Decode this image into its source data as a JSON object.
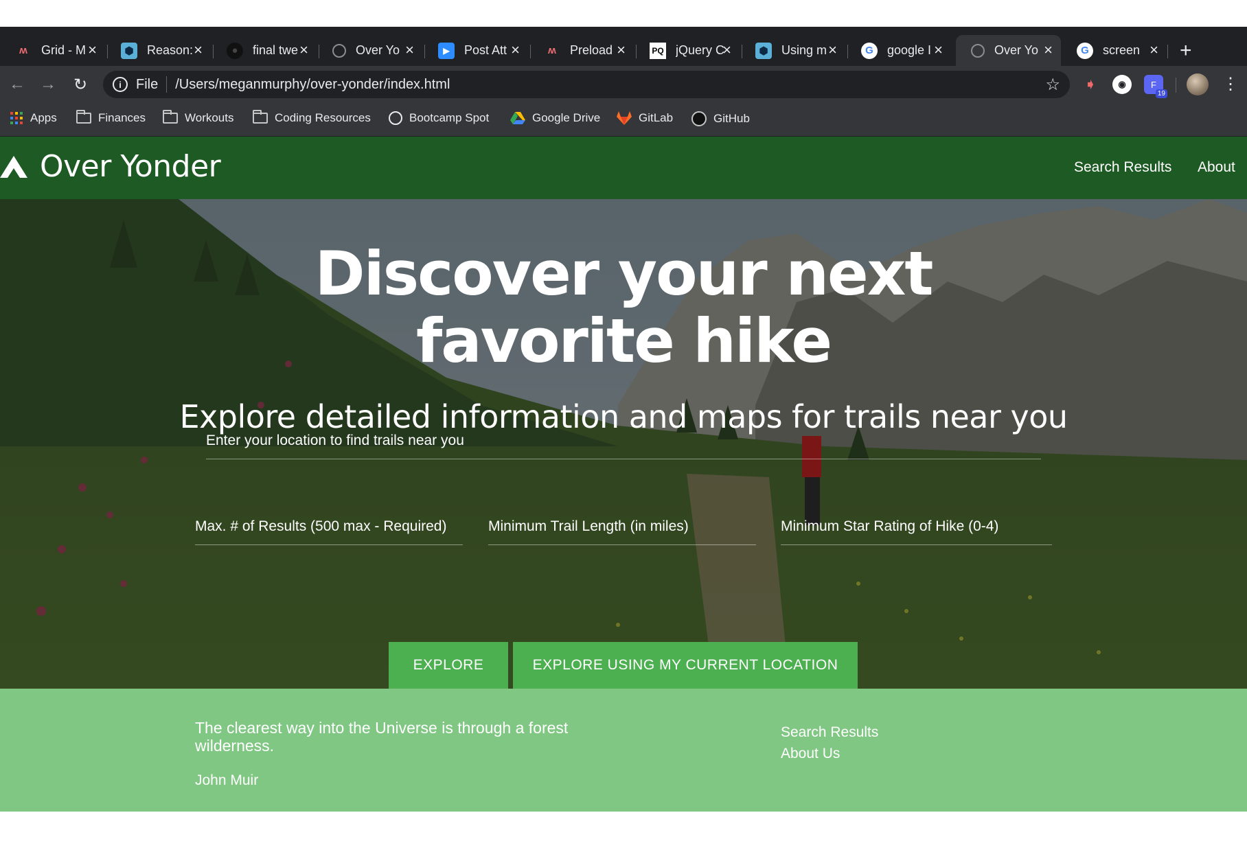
{
  "browser": {
    "tabs": [
      {
        "title": "Grid - M",
        "favicon": "materialize-icon",
        "active": false
      },
      {
        "title": "Reason:",
        "favicon": "bootcamp-icon",
        "active": false
      },
      {
        "title": "final twe",
        "favicon": "github-icon",
        "active": false
      },
      {
        "title": "Over Yo",
        "favicon": "globe-icon",
        "active": false
      },
      {
        "title": "Post Att",
        "favicon": "zoom-icon",
        "active": false
      },
      {
        "title": "Preload",
        "favicon": "materialize-icon",
        "active": false
      },
      {
        "title": "jQuery C",
        "favicon": "pq-icon",
        "active": false
      },
      {
        "title": "Using m",
        "favicon": "bootcamp-icon",
        "active": false
      },
      {
        "title": "google I",
        "favicon": "google-icon",
        "active": false
      },
      {
        "title": "Over Yo",
        "favicon": "globe-icon",
        "active": true
      },
      {
        "title": "screen",
        "favicon": "google-icon",
        "active": false
      }
    ],
    "omnibox": {
      "scheme_label": "File",
      "url": "/Users/meganmurphy/over-yonder/index.html"
    },
    "extension_badge": "19",
    "bookmarks": [
      {
        "label": "Apps",
        "icon": "apps-grid-icon"
      },
      {
        "label": "Finances",
        "icon": "folder-icon"
      },
      {
        "label": "Workouts",
        "icon": "folder-icon"
      },
      {
        "label": "Coding Resources",
        "icon": "folder-icon"
      },
      {
        "label": "Bootcamp Spot",
        "icon": "globe-icon"
      },
      {
        "label": "Google Drive",
        "icon": "google-drive-icon"
      },
      {
        "label": "GitLab",
        "icon": "gitlab-icon"
      },
      {
        "label": "GitHub",
        "icon": "github-icon"
      }
    ]
  },
  "site": {
    "brand": "Over Yonder",
    "nav": {
      "search_results": "Search Results",
      "about": "About"
    },
    "hero": {
      "title": "Discover your next favorite hike",
      "subtitle": "Explore detailed information and maps for trails near you",
      "location_label": "Enter your location to find trails near you",
      "max_results_label": "Max. # of Results (500 max - Required)",
      "min_length_label": "Minimum Trail Length (in miles)",
      "min_rating_label": "Minimum Star Rating of Hike (0-4)",
      "explore_button": "EXPLORE",
      "explore_location_button": "EXPLORE USING MY CURRENT LOCATION"
    },
    "footer": {
      "quote": "The clearest way into the Universe is through a forest wilderness.",
      "author": "John Muir",
      "links": {
        "search_results": "Search Results",
        "about_us": "About Us"
      }
    }
  },
  "colors": {
    "navbar": "#1e5b24",
    "button": "#4caf50",
    "footer": "#81c784",
    "chrome_dark": "#202124",
    "chrome_toolbar": "#35363a"
  }
}
